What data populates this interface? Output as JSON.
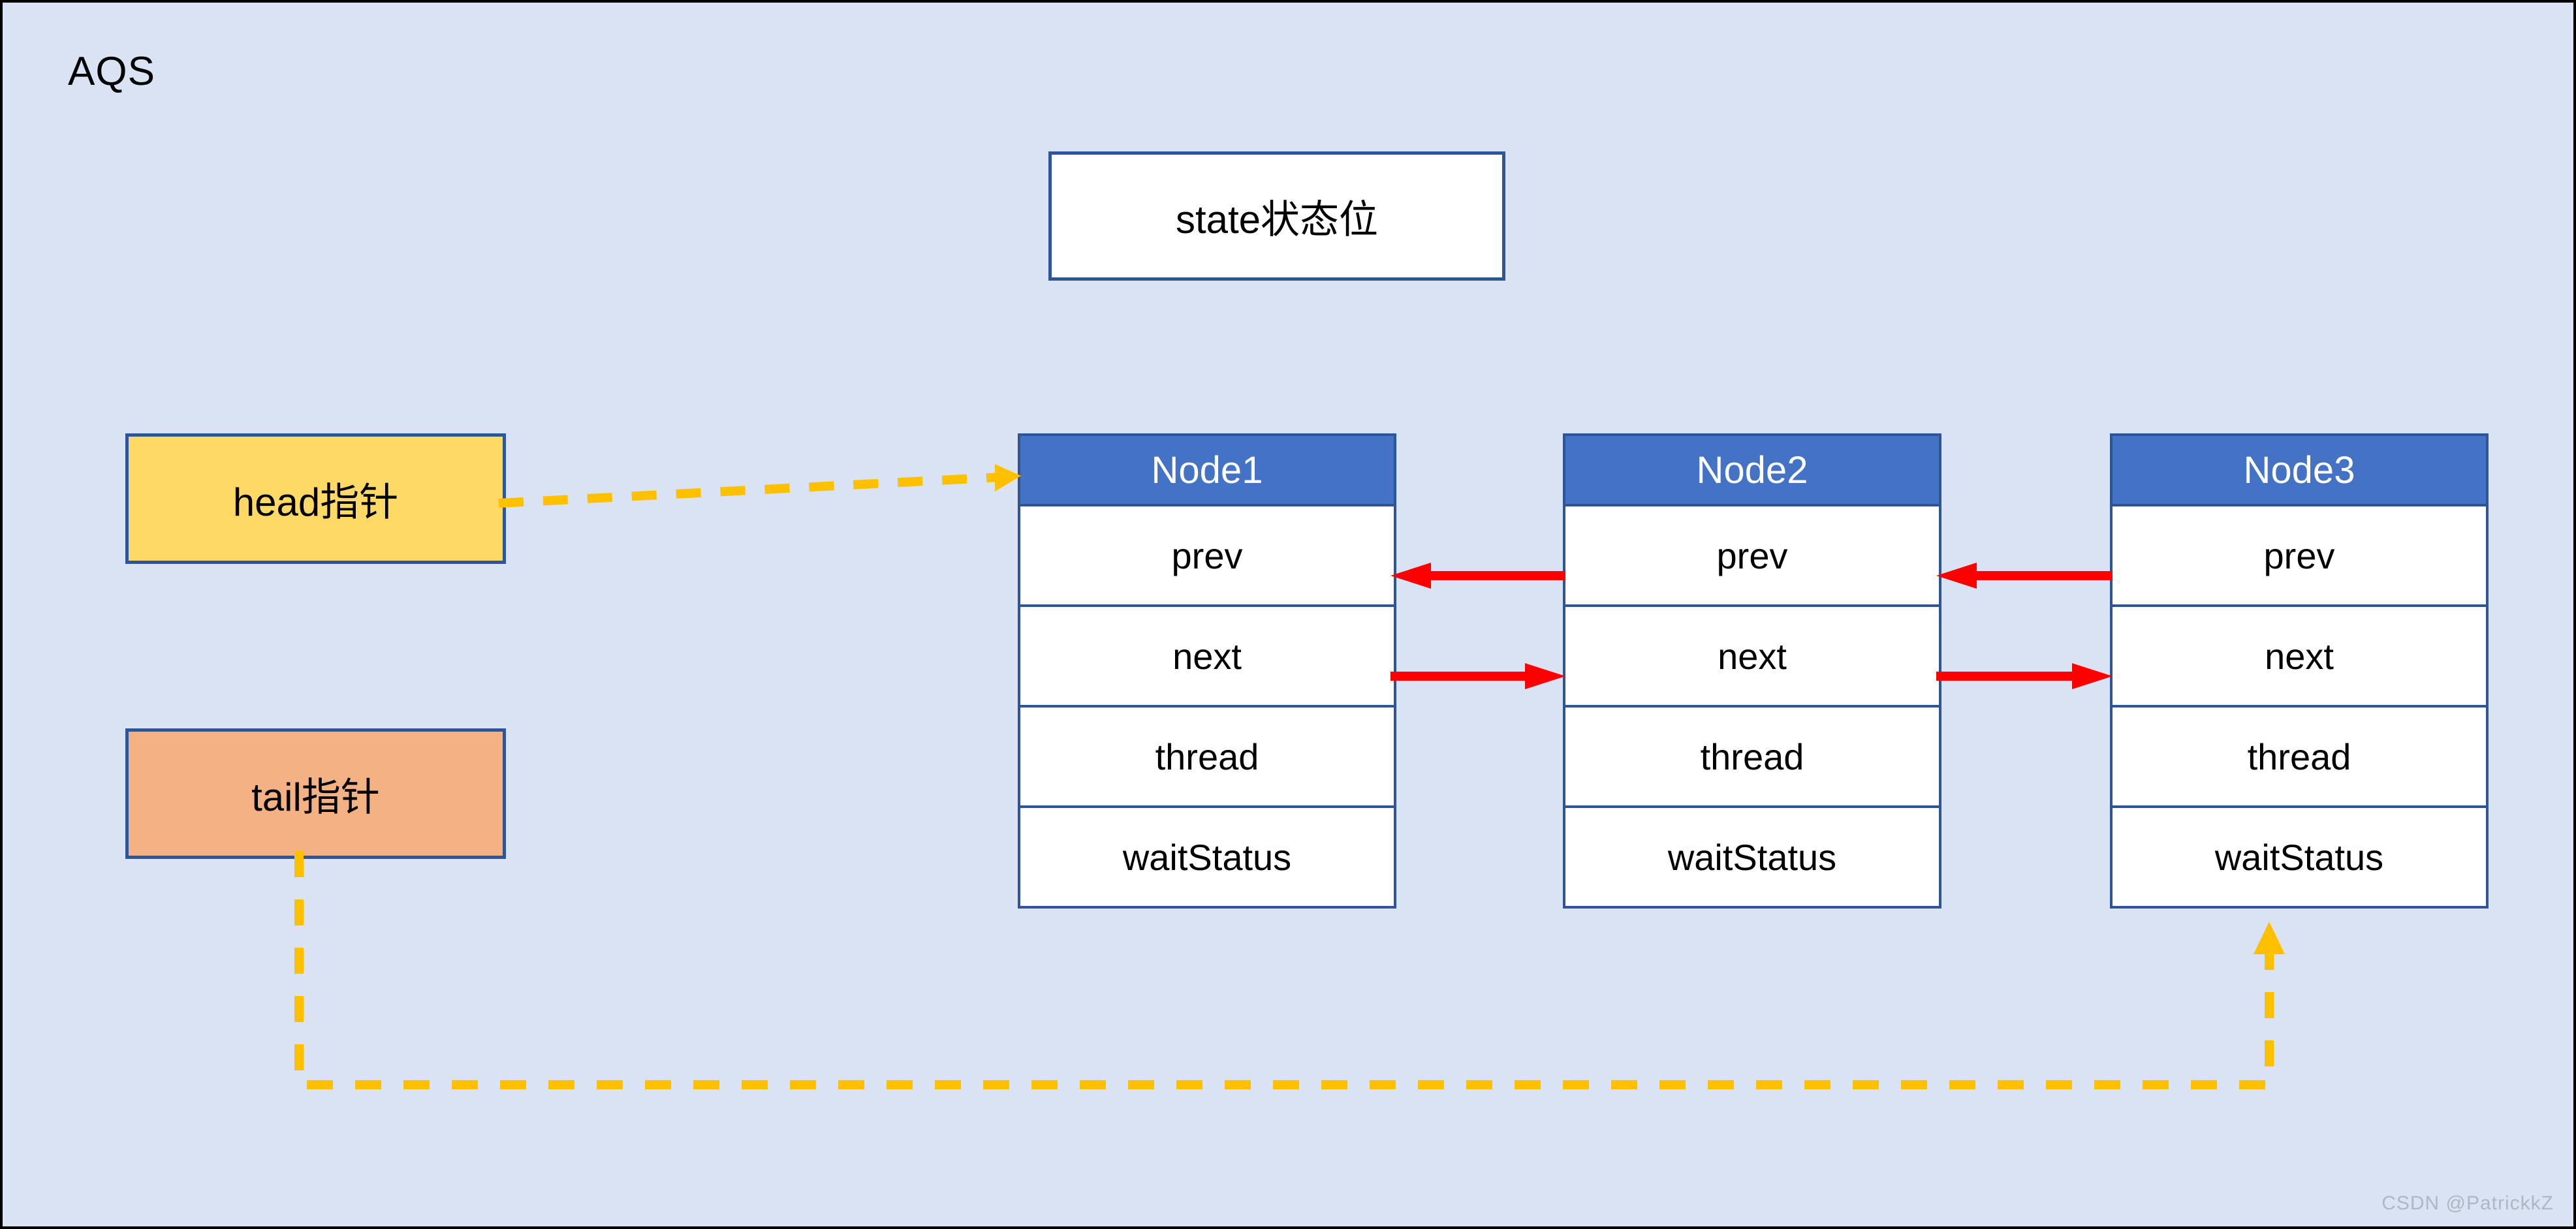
{
  "diagram": {
    "title": "AQS",
    "background_color": "#DAE3F3",
    "watermark": "CSDN @PatrickkZ"
  },
  "state_box": {
    "label": "state状态位",
    "fill": "#FFFFFF",
    "border": "#2E5597"
  },
  "pointers": [
    {
      "id": "head",
      "label": "head指针",
      "fill": "#FFD965",
      "border": "#2E5597",
      "target": "Node1",
      "line_style": "dashed",
      "line_color": "#FFC000"
    },
    {
      "id": "tail",
      "label": "tail指针",
      "fill": "#F4B183",
      "border": "#2E5597",
      "target": "Node3",
      "line_style": "dashed",
      "line_color": "#FFC000"
    }
  ],
  "nodes": [
    {
      "title": "Node1",
      "fields": [
        "prev",
        "next",
        "thread",
        "waitStatus"
      ],
      "header_fill": "#4472C4",
      "header_text_color": "#FFFFFF"
    },
    {
      "title": "Node2",
      "fields": [
        "prev",
        "next",
        "thread",
        "waitStatus"
      ],
      "header_fill": "#4472C4",
      "header_text_color": "#FFFFFF"
    },
    {
      "title": "Node3",
      "fields": [
        "prev",
        "next",
        "thread",
        "waitStatus"
      ],
      "header_fill": "#4472C4",
      "header_text_color": "#FFFFFF"
    }
  ],
  "links": [
    {
      "from": "Node2",
      "to": "Node1",
      "field": "prev",
      "direction": "left",
      "color": "#FF0000"
    },
    {
      "from": "Node1",
      "to": "Node2",
      "field": "next",
      "direction": "right",
      "color": "#FF0000"
    },
    {
      "from": "Node3",
      "to": "Node2",
      "field": "prev",
      "direction": "left",
      "color": "#FF0000"
    },
    {
      "from": "Node2",
      "to": "Node3",
      "field": "next",
      "direction": "right",
      "color": "#FF0000"
    }
  ]
}
